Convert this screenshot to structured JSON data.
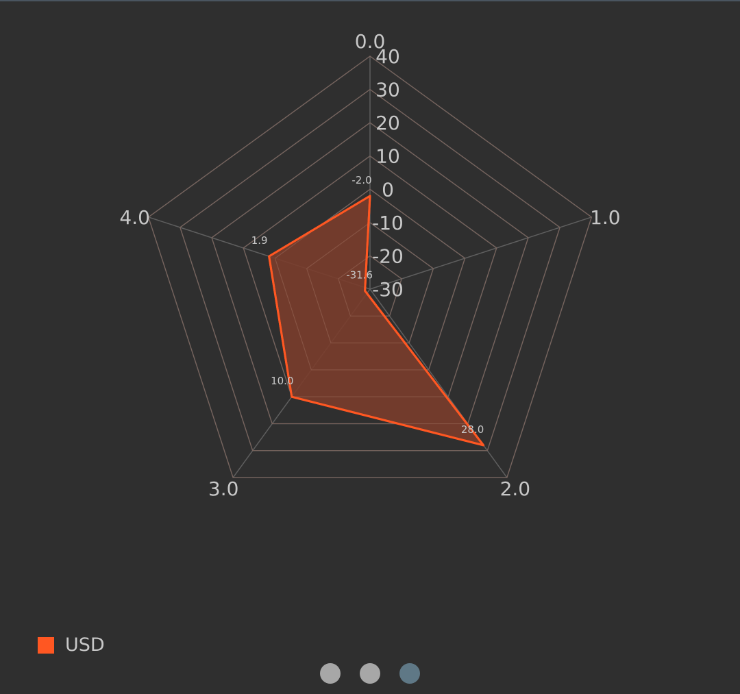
{
  "chart_data": {
    "type": "radar",
    "categories": [
      "0.0",
      "1.0",
      "2.0",
      "3.0",
      "4.0"
    ],
    "scale_labels": [
      "-30",
      "-20",
      "-10",
      "0",
      "10",
      "20",
      "30",
      "40"
    ],
    "rlim": [
      -30,
      40
    ],
    "series": [
      {
        "name": "USD",
        "values": [
          -2.0,
          -31.6,
          28.0,
          10.0,
          1.9
        ],
        "value_labels": [
          "-2.0",
          "-31.6",
          "28.0",
          "10.0",
          "1.9"
        ],
        "color": "#ff5722"
      }
    ],
    "grid": true,
    "legend": "bottom-left"
  },
  "pager": {
    "count": 3,
    "active_index": 2
  },
  "colors": {
    "background": "#2f2f2f",
    "grid": "#5f5f5f",
    "label": "#c8c8c8",
    "series": "#ff5722",
    "series_fill": "#7a3d2c",
    "dot_inactive": "#a7a7a7",
    "dot_active": "#5f7886"
  }
}
